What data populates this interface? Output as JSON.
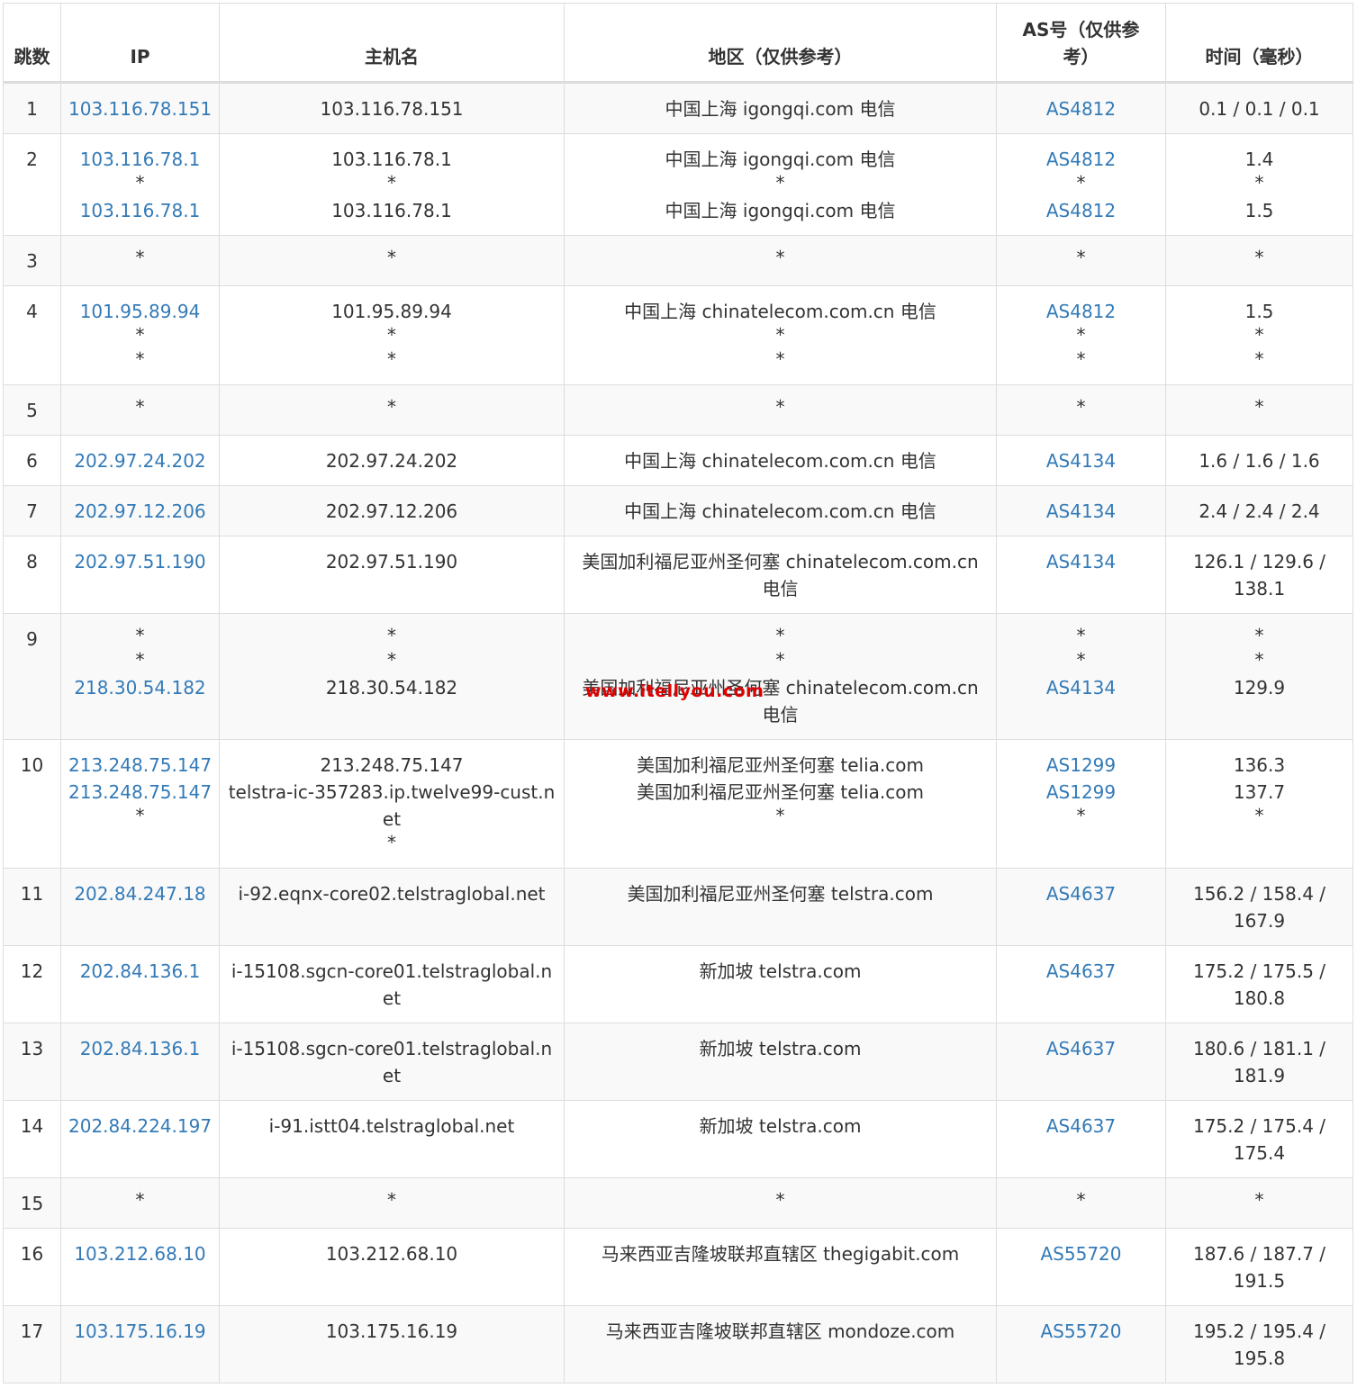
{
  "headers": {
    "hop": "跳数",
    "ip": "IP",
    "host": "主机名",
    "region": "地区（仅供参考）",
    "as": "AS号（仅供参考）",
    "time": "时间（毫秒）"
  },
  "watermark": "www.itellyou.com",
  "colors": {
    "link": "#337ab7",
    "stripe": "#f9f9f9",
    "border": "#dddddd",
    "watermark": "#e00000"
  },
  "rows": [
    {
      "hop": "1",
      "ip": [
        "103.116.78.151"
      ],
      "host": [
        "103.116.78.151"
      ],
      "region": [
        "中国上海 igongqi.com 电信"
      ],
      "as": [
        "AS4812"
      ],
      "time": [
        "0.1 / 0.1 / 0.1"
      ]
    },
    {
      "hop": "2",
      "ip": [
        "103.116.78.1",
        "*",
        "103.116.78.1"
      ],
      "host": [
        "103.116.78.1",
        "*",
        "103.116.78.1"
      ],
      "region": [
        "中国上海 igongqi.com 电信",
        "*",
        "中国上海 igongqi.com 电信"
      ],
      "as": [
        "AS4812",
        "*",
        "AS4812"
      ],
      "time": [
        "1.4",
        "*",
        "1.5"
      ]
    },
    {
      "hop": "3",
      "ip": [
        "*"
      ],
      "host": [
        "*"
      ],
      "region": [
        "*"
      ],
      "as": [
        "*"
      ],
      "time": [
        "*"
      ]
    },
    {
      "hop": "4",
      "ip": [
        "101.95.89.94",
        "*",
        "*"
      ],
      "host": [
        "101.95.89.94",
        "*",
        "*"
      ],
      "region": [
        "中国上海 chinatelecom.com.cn 电信",
        "*",
        "*"
      ],
      "as": [
        "AS4812",
        "*",
        "*"
      ],
      "time": [
        "1.5",
        "*",
        "*"
      ]
    },
    {
      "hop": "5",
      "ip": [
        "*"
      ],
      "host": [
        "*"
      ],
      "region": [
        "*"
      ],
      "as": [
        "*"
      ],
      "time": [
        "*"
      ]
    },
    {
      "hop": "6",
      "ip": [
        "202.97.24.202"
      ],
      "host": [
        "202.97.24.202"
      ],
      "region": [
        "中国上海 chinatelecom.com.cn 电信"
      ],
      "as": [
        "AS4134"
      ],
      "time": [
        "1.6 / 1.6 / 1.6"
      ]
    },
    {
      "hop": "7",
      "ip": [
        "202.97.12.206"
      ],
      "host": [
        "202.97.12.206"
      ],
      "region": [
        "中国上海 chinatelecom.com.cn 电信"
      ],
      "as": [
        "AS4134"
      ],
      "time": [
        "2.4 / 2.4 / 2.4"
      ]
    },
    {
      "hop": "8",
      "ip": [
        "202.97.51.190"
      ],
      "host": [
        "202.97.51.190"
      ],
      "region": [
        "美国加利福尼亚州圣何塞 chinatelecom.com.cn 电信"
      ],
      "as": [
        "AS4134"
      ],
      "time": [
        "126.1 / 129.6 / 138.1"
      ]
    },
    {
      "hop": "9",
      "ip": [
        "*",
        "*",
        "218.30.54.182"
      ],
      "host": [
        "*",
        "*",
        "218.30.54.182"
      ],
      "region": [
        "*",
        "*",
        "美国加利福尼亚州圣何塞 chinatelecom.com.cn 电信"
      ],
      "as": [
        "*",
        "*",
        "AS4134"
      ],
      "time": [
        "*",
        "*",
        "129.9"
      ]
    },
    {
      "hop": "10",
      "ip": [
        "213.248.75.147",
        "213.248.75.147",
        "*"
      ],
      "host": [
        "213.248.75.147",
        "telstra-ic-357283.ip.twelve99-cust.net",
        "*"
      ],
      "region": [
        "美国加利福尼亚州圣何塞 telia.com",
        "美国加利福尼亚州圣何塞 telia.com",
        "*"
      ],
      "as": [
        "AS1299",
        "AS1299",
        "*"
      ],
      "time": [
        "136.3",
        "137.7",
        "*"
      ]
    },
    {
      "hop": "11",
      "ip": [
        "202.84.247.18"
      ],
      "host": [
        "i-92.eqnx-core02.telstraglobal.net"
      ],
      "region": [
        "美国加利福尼亚州圣何塞 telstra.com"
      ],
      "as": [
        "AS4637"
      ],
      "time": [
        "156.2 / 158.4 / 167.9"
      ]
    },
    {
      "hop": "12",
      "ip": [
        "202.84.136.1"
      ],
      "host": [
        "i-15108.sgcn-core01.telstraglobal.net"
      ],
      "region": [
        "新加坡 telstra.com"
      ],
      "as": [
        "AS4637"
      ],
      "time": [
        "175.2 / 175.5 / 180.8"
      ]
    },
    {
      "hop": "13",
      "ip": [
        "202.84.136.1"
      ],
      "host": [
        "i-15108.sgcn-core01.telstraglobal.net"
      ],
      "region": [
        "新加坡 telstra.com"
      ],
      "as": [
        "AS4637"
      ],
      "time": [
        "180.6 / 181.1 / 181.9"
      ]
    },
    {
      "hop": "14",
      "ip": [
        "202.84.224.197"
      ],
      "host": [
        "i-91.istt04.telstraglobal.net"
      ],
      "region": [
        "新加坡 telstra.com"
      ],
      "as": [
        "AS4637"
      ],
      "time": [
        "175.2 / 175.4 / 175.4"
      ]
    },
    {
      "hop": "15",
      "ip": [
        "*"
      ],
      "host": [
        "*"
      ],
      "region": [
        "*"
      ],
      "as": [
        "*"
      ],
      "time": [
        "*"
      ]
    },
    {
      "hop": "16",
      "ip": [
        "103.212.68.10"
      ],
      "host": [
        "103.212.68.10"
      ],
      "region": [
        "马来西亚吉隆坡联邦直辖区 thegigabit.com"
      ],
      "as": [
        "AS55720"
      ],
      "time": [
        "187.6 / 187.7 / 191.5"
      ]
    },
    {
      "hop": "17",
      "ip": [
        "103.175.16.19"
      ],
      "host": [
        "103.175.16.19"
      ],
      "region": [
        "马来西亚吉隆坡联邦直辖区 mondoze.com"
      ],
      "as": [
        "AS55720"
      ],
      "time": [
        "195.2 / 195.4 / 195.8"
      ]
    }
  ]
}
